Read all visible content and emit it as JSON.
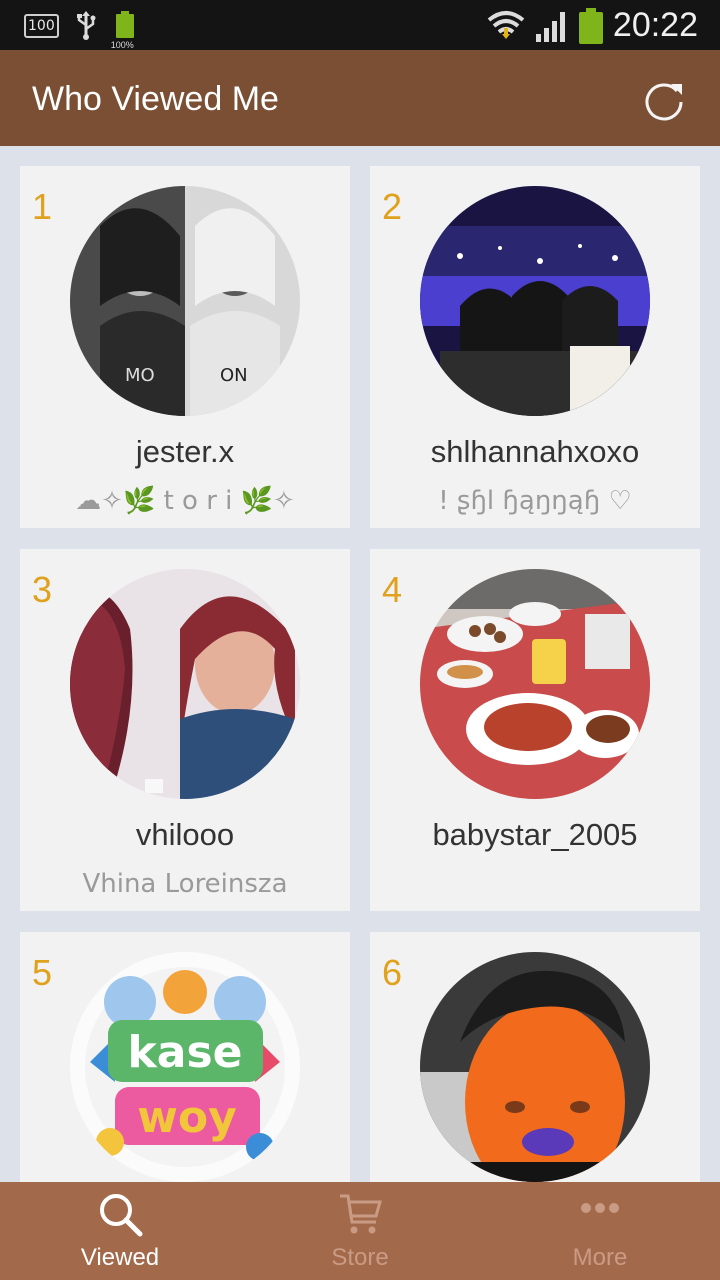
{
  "status_bar": {
    "storage_badge": "100",
    "battery_small_pct": "100%",
    "time": "20:22"
  },
  "header": {
    "title": "Who Viewed Me",
    "refresh_icon": "refresh-icon"
  },
  "viewers": [
    {
      "rank": "1",
      "username": "jester.x",
      "full_name": "☁✧🌿 t o r i 🌿✧"
    },
    {
      "rank": "2",
      "username": "shlhannahxoxo",
      "full_name": "! ʂɧl ɧąŋŋąɧ ♡"
    },
    {
      "rank": "3",
      "username": "vhilooo",
      "full_name": "Vhina Loreinsza"
    },
    {
      "rank": "4",
      "username": "babystar_2005",
      "full_name": ""
    },
    {
      "rank": "5",
      "username": "",
      "full_name": ""
    },
    {
      "rank": "6",
      "username": "",
      "full_name": ""
    }
  ],
  "bottom_nav": {
    "items": [
      {
        "label": "Viewed",
        "icon": "search-icon",
        "active": true
      },
      {
        "label": "Store",
        "icon": "cart-icon",
        "active": false
      },
      {
        "label": "More",
        "icon": "more-icon",
        "active": false
      }
    ]
  },
  "colors": {
    "header": "#7a4f34",
    "bottom_nav": "#a3694b",
    "rank": "#e0a11c",
    "background": "#dde1ea"
  }
}
